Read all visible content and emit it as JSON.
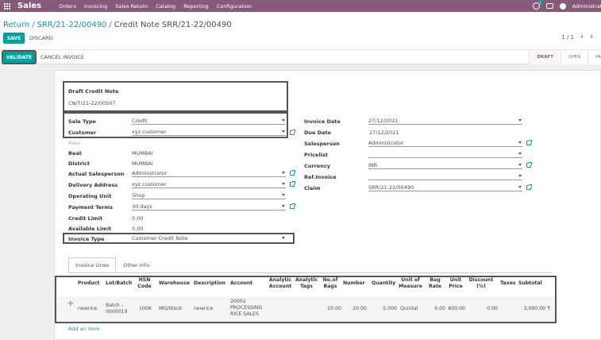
{
  "navbar": {
    "brand": "Sales",
    "menu": [
      "Orders",
      "Invoicing",
      "Sales Return",
      "Catalog",
      "Reporting",
      "Configuration"
    ],
    "activity_count": "1",
    "user": "Administrator"
  },
  "breadcrumb": {
    "b1": "Return",
    "b2": "SRR/21-22/00490",
    "b3": "Credit Note SRR/21-22/00490"
  },
  "buttons": {
    "save": "SAVE",
    "discard": "DISCARD",
    "validate": "VALIDATE",
    "cancel_invoice": "CANCEL INVOICE"
  },
  "pager": {
    "value": "1 / 1",
    "prev": "‹",
    "next": "›"
  },
  "states": [
    "DRAFT",
    "OPEN",
    "PA"
  ],
  "form": {
    "title": "Draft Credit Note",
    "number": "CN/T/21-22/00507",
    "left": {
      "sale_type": {
        "label": "Sale Type",
        "value": "Credit"
      },
      "customer": {
        "label": "Customer",
        "value": "xyz customer"
      },
      "area": {
        "label": "Area"
      },
      "beat": {
        "label": "Beat",
        "value": "MUMBAI"
      },
      "district": {
        "label": "District",
        "value": "MUMBAI"
      },
      "actual_salesperson": {
        "label": "Actual Salesperson",
        "value": "Administrator"
      },
      "delivery_address": {
        "label": "Delivery Address",
        "value": "xyz customer"
      },
      "operating_unit": {
        "label": "Operating Unit",
        "value": "Shop"
      },
      "payment_terms": {
        "label": "Payment Terms",
        "value": "30 days"
      },
      "credit_limit": {
        "label": "Credit Limit",
        "value": "0.00"
      },
      "available_limit": {
        "label": "Available Limit",
        "value": "0.00"
      },
      "invoice_type": {
        "label": "Invoice Type",
        "value": "Customer Credit Note"
      }
    },
    "right": {
      "invoice_date": {
        "label": "Invoice Date",
        "value": "27/12/2021"
      },
      "due_date": {
        "label": "Due Date",
        "value": "27/12/2021"
      },
      "salesperson": {
        "label": "Salesperson",
        "value": "Administrator"
      },
      "pricelist": {
        "label": "Pricelist",
        "value": ""
      },
      "currency": {
        "label": "Currency",
        "value": "INR"
      },
      "ref_invoice": {
        "label": "Ref.Invoice",
        "value": ""
      },
      "claim": {
        "label": "Claim",
        "value": "SRR/21-22/00490"
      }
    }
  },
  "tabs": [
    "Invoice Lines",
    "Other Info"
  ],
  "invoice_lines": {
    "headers": {
      "product": "Product",
      "lot_batch": "Lot/Batch",
      "hsn": "HSN Code",
      "warehouse": "Warehouse",
      "description": "Description",
      "account": "Account",
      "analytic_account": "Analytic Account",
      "analytic_tags": "Analytic Tags",
      "no_of_bags": "No.of Bags",
      "number": "Number",
      "quantity": "Quantity",
      "uom": "Unit of Measure",
      "bag_rate": "Bag Rate",
      "unit_price": "Unit Price",
      "discount": "Discount (%)",
      "taxes": "Taxes",
      "subtotal": "Subtotal"
    },
    "rows": [
      {
        "product": "newrice",
        "lot_batch": "Batch - 0000019",
        "hsn": "1006",
        "warehouse": "MG/Stock",
        "description": "newrice",
        "account": "20002 PROCESSING RICE SALES",
        "no_of_bags": "20.00",
        "number": "20.00",
        "quantity": "5.000",
        "uom": "Quintal",
        "bag_rate": "0.00",
        "unit_price": "600.00",
        "discount": "0.00",
        "subtotal": "3,000.00 ₹"
      }
    ],
    "add_item": "Add an item"
  },
  "colors": {
    "navbar": "#875a7b",
    "accent": "#00a09d"
  }
}
